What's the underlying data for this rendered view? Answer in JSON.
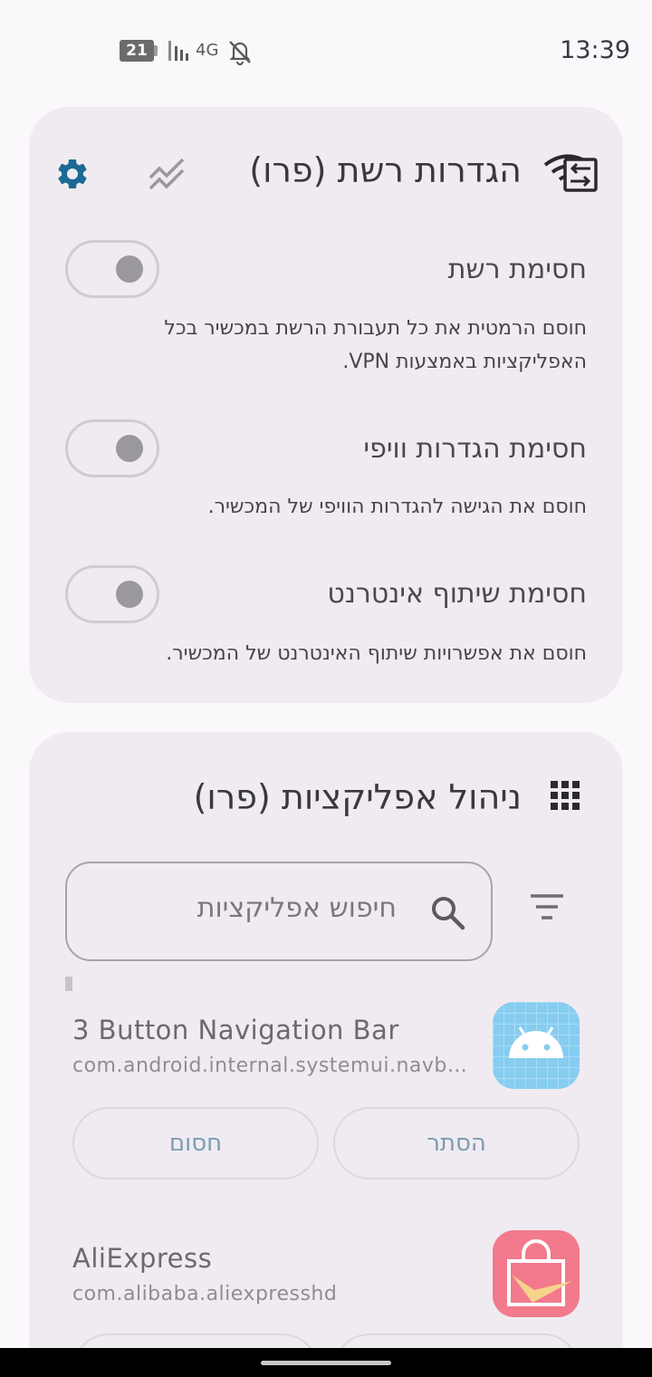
{
  "status_bar": {
    "time": "13:39",
    "battery_level": "21",
    "network_type": "4G",
    "icons": [
      "battery-icon",
      "signal-icon",
      "bell-off-icon"
    ]
  },
  "network_card": {
    "title": "הגדרות רשת (פרו)",
    "header_icons": [
      "wifi-switch-icon",
      "chart-trend-icon",
      "gear-icon"
    ],
    "items": [
      {
        "title": "חסימת רשת",
        "description": "חוסם הרמטית את כל תעבורת הרשת במכשיר בכל האפליקציות באמצעות VPN.",
        "enabled": false
      },
      {
        "title": "חסימת הגדרות וויפי",
        "description": "חוסם את הגישה להגדרות הוויפי של המכשיר.",
        "enabled": false
      },
      {
        "title": "חסימת שיתוף אינטרנט",
        "description": "חוסם את אפשרויות שיתוף האינטרנט של המכשיר.",
        "enabled": false
      }
    ]
  },
  "apps_card": {
    "title": "ניהול אפליקציות (פרו)",
    "search_placeholder": "חיפוש אפליקציות",
    "apps": [
      {
        "name": "3 Button Navigation Bar",
        "package": "com.android.internal.systemui.navb…",
        "hide_label": "הסתר",
        "block_label": "חסום"
      },
      {
        "name": "AliExpress",
        "package": "com.alibaba.aliexpresshd"
      }
    ]
  },
  "colors": {
    "accent": "#1b6a93",
    "card_bg": "#efebf0",
    "page_bg": "#fbf8fc",
    "button_text": "#7d9cb4"
  }
}
